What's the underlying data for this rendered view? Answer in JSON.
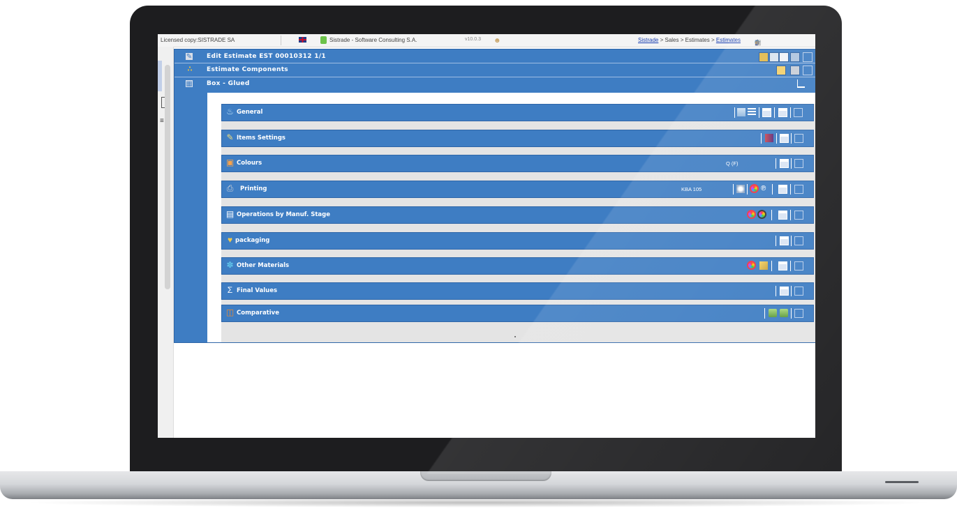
{
  "topbar": {
    "license": "Licensed copy:SISTRADE SA",
    "company": "Sistrade - Software Consulting S.A.",
    "version": "v10.0.3",
    "breadcrumb": {
      "root": "Sistrade",
      "sep1": " > ",
      "sales": "Sales",
      "sep2": " > ",
      "estimates_plain": "Estimates",
      "sep3": " > ",
      "estimates_link": "Estimates"
    }
  },
  "headers": [
    {
      "label": "Edit Estimate  EST  00010312  1/1",
      "icon": "edit-icon"
    },
    {
      "label": "Estimate Components",
      "icon": "components-icon"
    },
    {
      "label": "Box - Glued",
      "icon": "box-icon"
    }
  ],
  "panels": [
    {
      "label": "General",
      "icon": "general-icon",
      "value": ""
    },
    {
      "label": "Items Settings",
      "icon": "items-settings-icon",
      "value": ""
    },
    {
      "label": "Colours",
      "icon": "colours-icon",
      "value": "Q (F)"
    },
    {
      "label": "Printing",
      "icon": "printer-icon",
      "value": "KBA 105"
    },
    {
      "label": "Operations by Manuf. Stage",
      "icon": "operations-icon",
      "value": ""
    },
    {
      "label": "packaging",
      "icon": "packaging-icon",
      "value": ""
    },
    {
      "label": "Other Materials",
      "icon": "materials-icon",
      "value": ""
    },
    {
      "label": "Final Values",
      "icon": "final-values-icon",
      "value": ""
    },
    {
      "label": "Comparative",
      "icon": "comparative-icon",
      "value": ""
    }
  ],
  "colors": {
    "header_blue": "#3e7dc3",
    "panel_bg": "#e4e4e4",
    "laptop_bezel": "#1d1d1f"
  }
}
